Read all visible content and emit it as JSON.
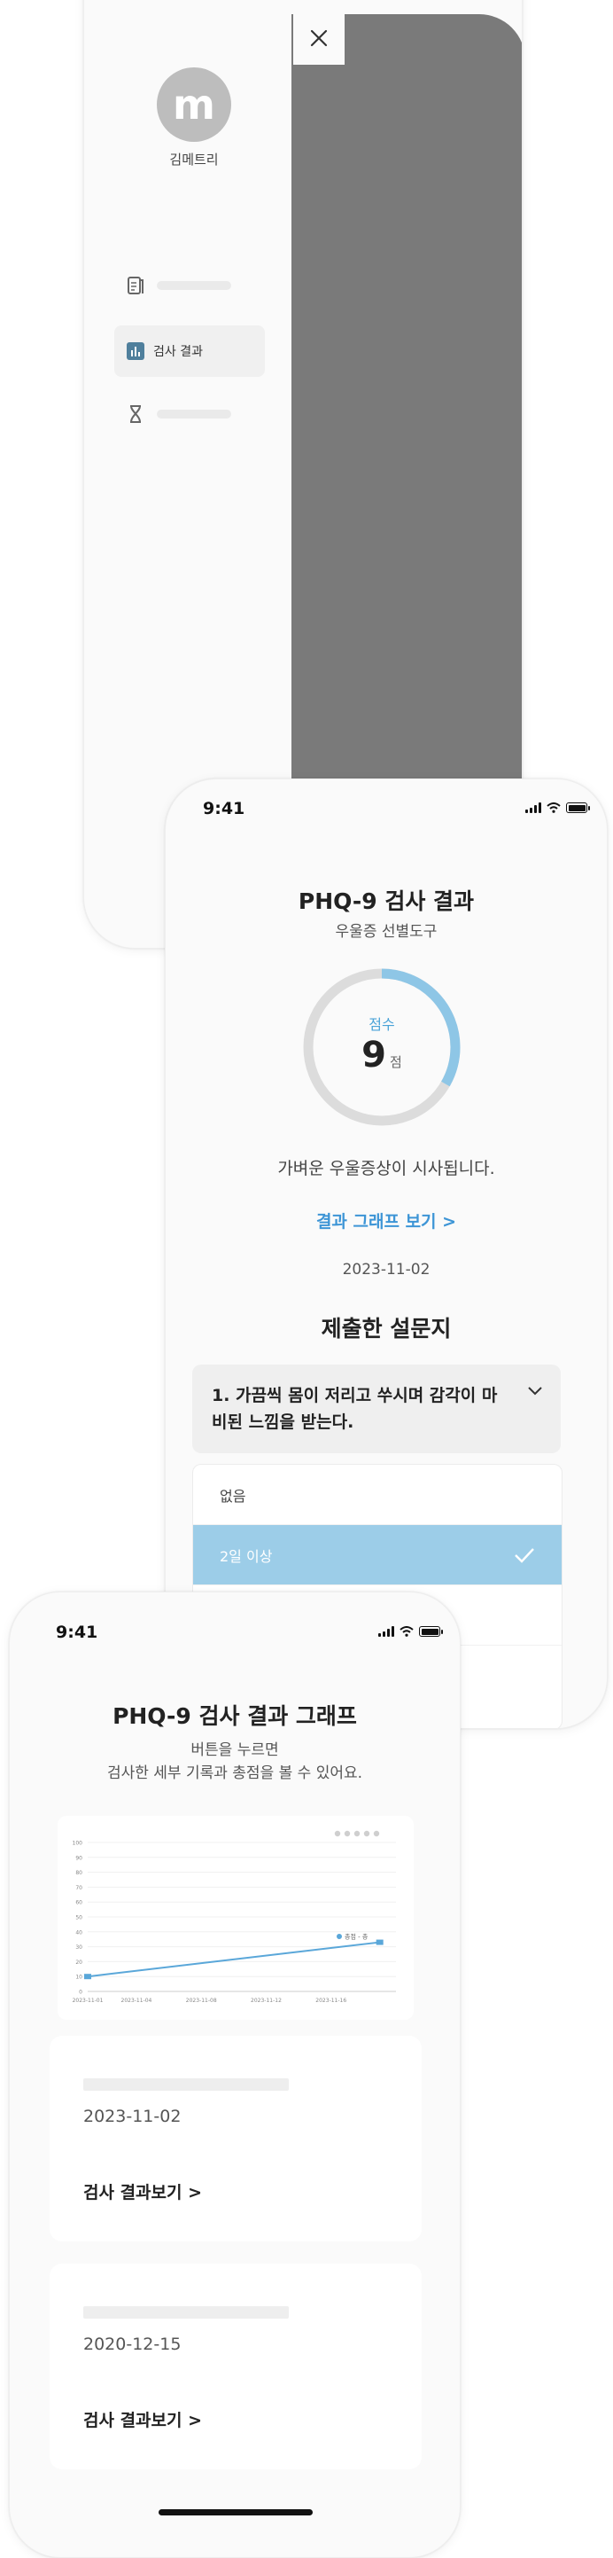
{
  "menu": {
    "user_name": "김메트리",
    "avatar_letter": "m",
    "items": [
      {
        "icon": "document-icon",
        "label": ""
      },
      {
        "icon": "bar-chart-icon",
        "label": "검사 결과"
      },
      {
        "icon": "hourglass-icon",
        "label": ""
      }
    ]
  },
  "status": {
    "time": "9:41"
  },
  "result": {
    "title": "PHQ-9 검사 결과",
    "subtitle": "우울증 선별도구",
    "score_label": "점수",
    "score": "9",
    "score_unit": "점",
    "score_max": 27,
    "description": "가벼운 우울증상이 시사됩니다.",
    "graph_link": "결과 그래프 보기 >",
    "date": "2023-11-02",
    "section_title": "제출한 설문지",
    "question": "1. 가끔씩 몸이 저리고 쑤시며 감각이 마비된 느낌을 받는다.",
    "options": [
      {
        "label": "없음",
        "selected": false
      },
      {
        "label": "2일 이상",
        "selected": true
      },
      {
        "label": "",
        "selected": false
      }
    ]
  },
  "graph": {
    "title": "PHQ-9 검사 결과 그래프",
    "subtitle_line1": "버튼을 누르면",
    "subtitle_line2": "검사한  세부 기록과 총점을 볼 수 있어요.",
    "cards": [
      {
        "date": "2023-11-02",
        "link": "검사 결과보기 >"
      },
      {
        "date": "2020-12-15",
        "link": "검사 결과보기 >"
      }
    ]
  },
  "chart_data": {
    "type": "line",
    "x": [
      "2023-11-01",
      "2023-11-04",
      "2023-11-08",
      "2023-11-12",
      "2023-11-16"
    ],
    "x_points": [
      "2023-11-01",
      "2023-11-19"
    ],
    "y_points": [
      10,
      33
    ],
    "ylim": [
      0,
      100
    ],
    "yticks": [
      0,
      10,
      20,
      30,
      40,
      50,
      60,
      70,
      80,
      90,
      100
    ],
    "legend": "총점 - 총",
    "grid": true,
    "colors": {
      "line": "#5aa7d9",
      "point": "#5aa7d9"
    }
  },
  "colors": {
    "accent": "#3d95d6",
    "gauge_track": "#dcdcdc",
    "gauge_fill": "#8ec6e6",
    "selected_option": "#9ccde8"
  }
}
